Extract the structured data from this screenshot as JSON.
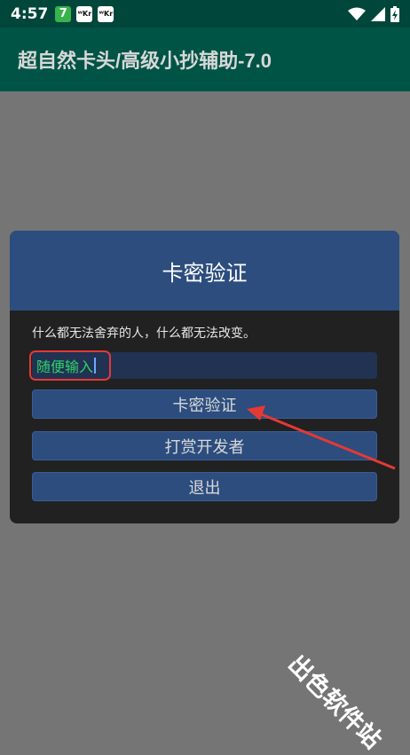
{
  "status_bar": {
    "time": "4:57",
    "notif_1": "7",
    "notif_2": "ᵂKr",
    "notif_3": "ᵂKr"
  },
  "app_bar": {
    "title": "超自然卡头/高级小抄辅助-7.0"
  },
  "dialog": {
    "title": "卡密验证",
    "message": "什么都无法舍弃的人，什么都无法改变。",
    "input": {
      "value": "随便输入"
    },
    "buttons": {
      "verify": "卡密验证",
      "tip": "打赏开发者",
      "exit": "退出"
    }
  },
  "watermark": "出色软件站",
  "colors": {
    "app_bar": "#005446",
    "status_bar": "#00463a",
    "dialog_header": "#2c4d7e",
    "dialog_bg": "#212121",
    "input_text": "#2fd36a",
    "annotation": "#e53935"
  },
  "icons": [
    "wifi-icon",
    "signal-icon",
    "battery-icon"
  ]
}
